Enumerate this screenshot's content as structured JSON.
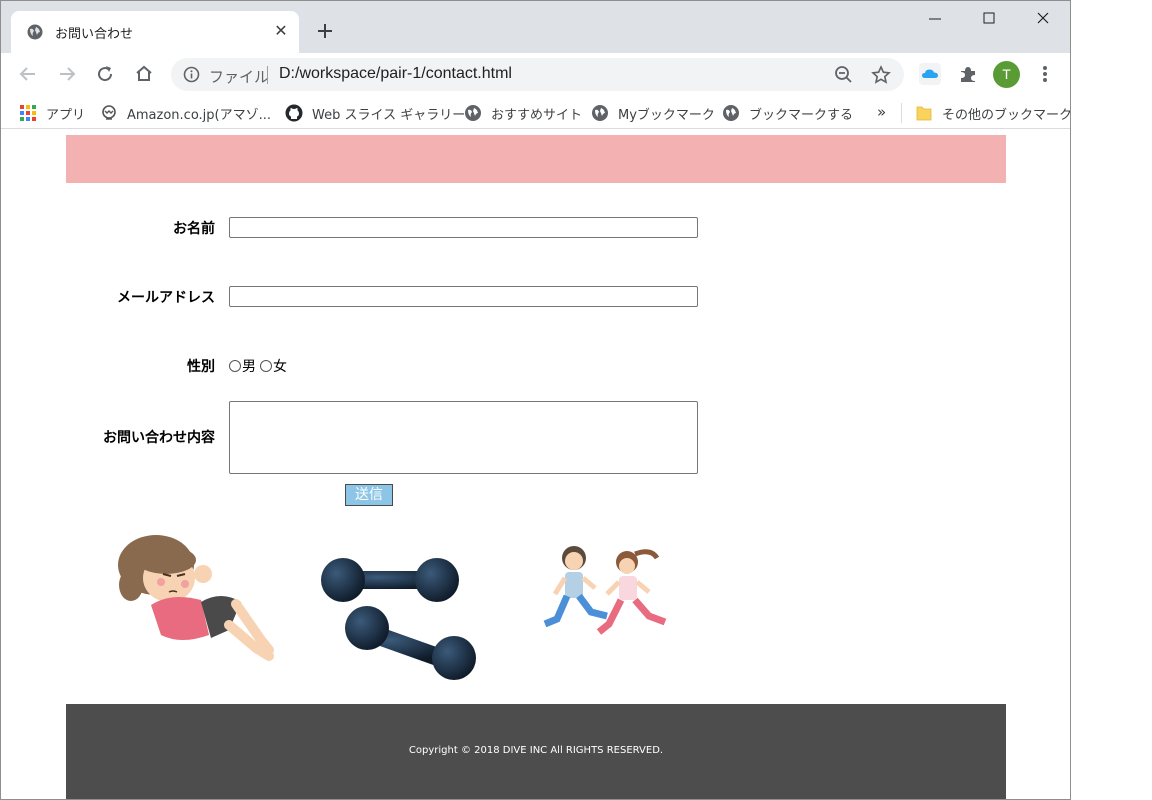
{
  "browser": {
    "tab_title": "お問い合わせ",
    "scheme_label": "ファイル",
    "url": "D:/workspace/pair-1/contact.html",
    "profile_initial": "T"
  },
  "bookmarks": {
    "apps": "アプリ",
    "items": [
      {
        "label": "Amazon.co.jp(アマゾ...",
        "icon": "amazon-icon"
      },
      {
        "label": "Web スライス ギャラリー",
        "icon": "github-icon"
      },
      {
        "label": "おすすめサイト",
        "icon": "globe-icon"
      },
      {
        "label": "Myブックマーク",
        "icon": "globe-icon"
      },
      {
        "label": "ブックマークする",
        "icon": "globe-icon"
      }
    ],
    "more": "»",
    "other": "その他のブックマーク"
  },
  "form": {
    "name_label": "お名前",
    "email_label": "メールアドレス",
    "gender_label": "性別",
    "gender_options": [
      "男",
      "女"
    ],
    "message_label": "お問い合わせ内容",
    "submit_label": "送信"
  },
  "footer": {
    "copyright": "Copyright © 2018 DIVE INC All RIGHTS RESERVED."
  },
  "colors": {
    "header_band": "#f4b1b1",
    "footer_bg": "#4d4d4d",
    "submit_bg": "#8dc5e6",
    "avatar_bg": "#5a9b35"
  }
}
